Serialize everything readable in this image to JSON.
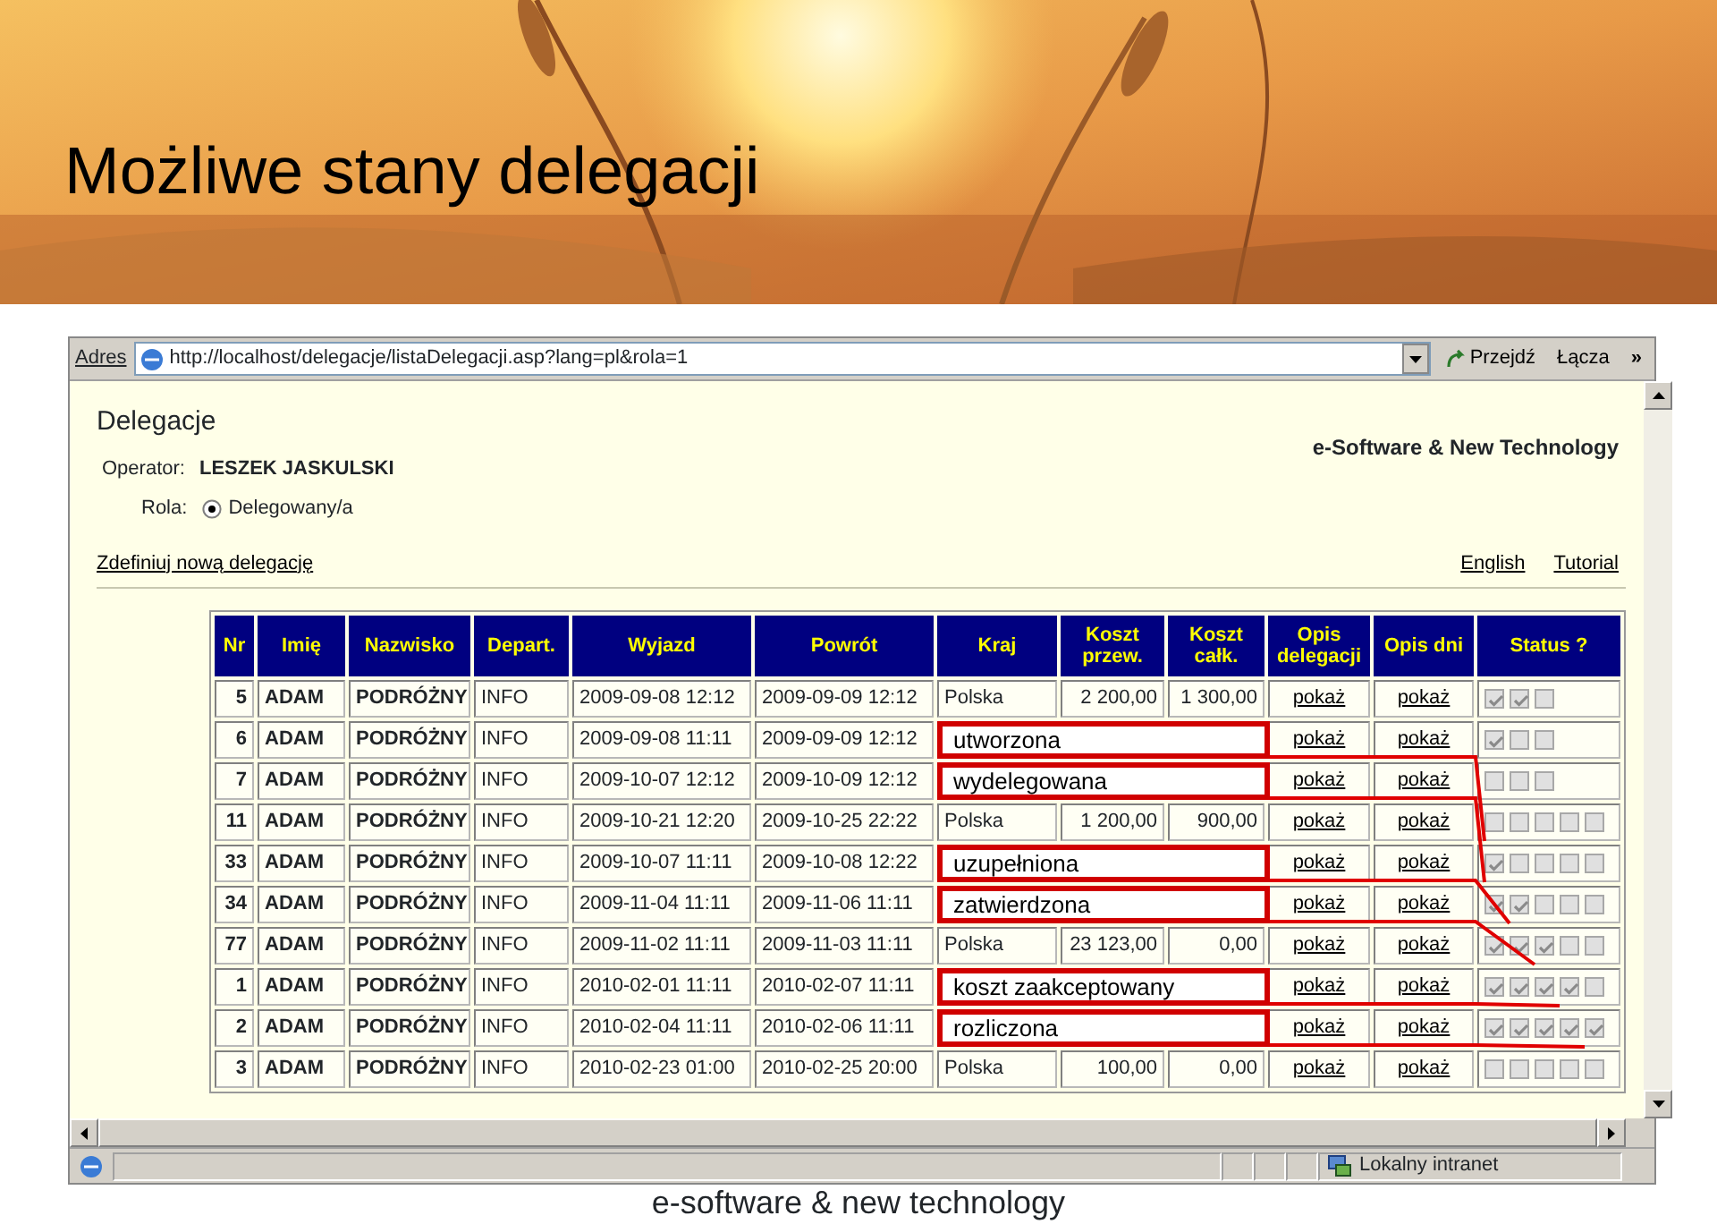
{
  "slide": {
    "title": "Możliwe stany delegacji",
    "footer": "e-software & new technology"
  },
  "browser": {
    "address_label": "Adres",
    "url": "http://localhost/delegacje/listaDelegacji.asp?lang=pl&rola=1",
    "go_button": "Przejdź",
    "links_label": "Łącza",
    "links_more": "»",
    "zone": "Lokalny intranet"
  },
  "page": {
    "heading": "Delegacje",
    "operator_label": "Operator:",
    "operator": "LESZEK JASKULSKI",
    "role_label": "Rola:",
    "roles": [
      {
        "label": "Delegowany/a",
        "selected": true
      }
    ],
    "company": "e-Software & New Technology",
    "new_link": "Zdefiniuj nową delegację",
    "links": [
      "English",
      "Tutorial"
    ]
  },
  "table": {
    "columns": [
      "Nr",
      "Imię",
      "Nazwisko",
      "Depart.",
      "Wyjazd",
      "Powrót",
      "Kraj",
      "Koszt przew.",
      "Koszt całk.",
      "Opis delegacji",
      "Opis dni",
      "Status ?"
    ],
    "rows": [
      {
        "nr": "5",
        "first_name": "ADAM",
        "last_name": "PODRÓŻNY",
        "department": "INFO",
        "departure": "2009-09-08 12:12",
        "return": "2009-09-09 12:12",
        "country": "Polska",
        "transport_cost": "2 200,00",
        "total_cost": "1 300,00",
        "description_link": "pokaż",
        "days_link": "pokaż",
        "status": [
          true,
          true,
          false
        ]
      },
      {
        "nr": "6",
        "first_name": "ADAM",
        "last_name": "PODRÓŻNY",
        "department": "INFO",
        "departure": "2009-09-08 11:11",
        "return": "2009-09-09 12:12",
        "description_link": "pokaż",
        "days_link": "pokaż",
        "status": [
          true,
          false,
          false
        ]
      },
      {
        "nr": "7",
        "first_name": "ADAM",
        "last_name": "PODRÓŻNY",
        "department": "INFO",
        "departure": "2009-10-07 12:12",
        "return": "2009-10-09 12:12",
        "description_link": "pokaż",
        "days_link": "pokaż",
        "status": [
          false,
          false,
          false
        ]
      },
      {
        "nr": "11",
        "first_name": "ADAM",
        "last_name": "PODRÓŻNY",
        "department": "INFO",
        "departure": "2009-10-21 12:20",
        "return": "2009-10-25 22:22",
        "country": "Polska",
        "transport_cost": "1 200,00",
        "total_cost": "900,00",
        "description_link": "pokaż",
        "days_link": "pokaż",
        "status": [
          false,
          false,
          false,
          false,
          false
        ]
      },
      {
        "nr": "33",
        "first_name": "ADAM",
        "last_name": "PODRÓŻNY",
        "department": "INFO",
        "departure": "2009-10-07 11:11",
        "return": "2009-10-08 12:22",
        "description_link": "pokaż",
        "days_link": "pokaż",
        "status": [
          true,
          false,
          false,
          false,
          false
        ]
      },
      {
        "nr": "34",
        "first_name": "ADAM",
        "last_name": "PODRÓŻNY",
        "department": "INFO",
        "departure": "2009-11-04 11:11",
        "return": "2009-11-06 11:11",
        "description_link": "pokaż",
        "days_link": "pokaż",
        "status": [
          true,
          true,
          false,
          false,
          false
        ]
      },
      {
        "nr": "77",
        "first_name": "ADAM",
        "last_name": "PODRÓŻNY",
        "department": "INFO",
        "departure": "2009-11-02 11:11",
        "return": "2009-11-03 11:11",
        "country": "Polska",
        "transport_cost": "23 123,00",
        "total_cost": "0,00",
        "description_link": "pokaż",
        "days_link": "pokaż",
        "status": [
          true,
          true,
          true,
          false,
          false
        ]
      },
      {
        "nr": "1",
        "first_name": "ADAM",
        "last_name": "PODRÓŻNY",
        "department": "INFO",
        "departure": "2010-02-01 11:11",
        "return": "2010-02-07 11:11",
        "description_link": "pokaż",
        "days_link": "pokaż",
        "status": [
          true,
          true,
          true,
          true,
          false
        ]
      },
      {
        "nr": "2",
        "first_name": "ADAM",
        "last_name": "PODRÓŻNY",
        "department": "INFO",
        "departure": "2010-02-04 11:11",
        "return": "2010-02-06 11:11",
        "description_link": "pokaż",
        "days_link": "pokaż",
        "status": [
          true,
          true,
          true,
          true,
          true
        ]
      },
      {
        "nr": "3",
        "first_name": "ADAM",
        "last_name": "PODRÓŻNY",
        "department": "INFO",
        "departure": "2010-02-23 01:00",
        "return": "2010-02-25 20:00",
        "country": "Polska",
        "transport_cost": "100,00",
        "total_cost": "0,00",
        "description_link": "pokaż",
        "days_link": "pokaż",
        "status": [
          false,
          false,
          false,
          false,
          false
        ]
      }
    ]
  },
  "callouts": [
    {
      "label": "utworzona"
    },
    {
      "label": "wydelegowana"
    },
    {
      "label": "uzupełniona"
    },
    {
      "label": "zatwierdzona"
    },
    {
      "label": "koszt zaakceptowany"
    },
    {
      "label": "rozliczona"
    }
  ]
}
